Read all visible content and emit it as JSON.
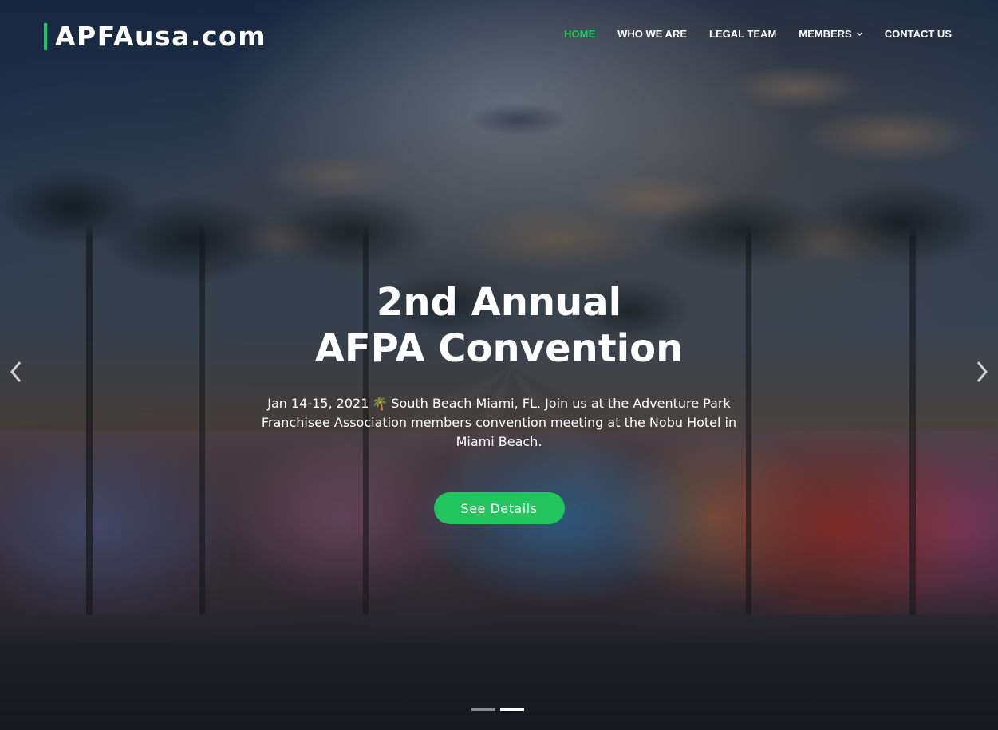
{
  "brand": {
    "logo_text": "APFAusa.com",
    "accent_color": "#22c55e"
  },
  "nav": {
    "items": [
      {
        "label": "HOME",
        "active": true
      },
      {
        "label": "WHO WE ARE",
        "active": false
      },
      {
        "label": "LEGAL TEAM",
        "active": false
      },
      {
        "label": "MEMBERS",
        "active": false,
        "has_dropdown": true,
        "icon": "chevron-down-icon"
      },
      {
        "label": "CONTACT US",
        "active": false
      }
    ]
  },
  "slide": {
    "title_line1": "2nd Annual",
    "title_line2": "AFPA Convention",
    "description_part1": "Jan 14-15, 2021",
    "description_emoji": "🌴",
    "description_part2": "South Beach Miami, FL. Join us at the Adventure Park Franchisee Association members convention meeting at the Nobu Hotel in Miami Beach.",
    "cta_label": "See Details",
    "cta_color": "#22c55e"
  },
  "carousel": {
    "prev_icon": "chevron-left-icon",
    "next_icon": "chevron-right-icon",
    "slide_count": 2,
    "active_index": 1
  }
}
